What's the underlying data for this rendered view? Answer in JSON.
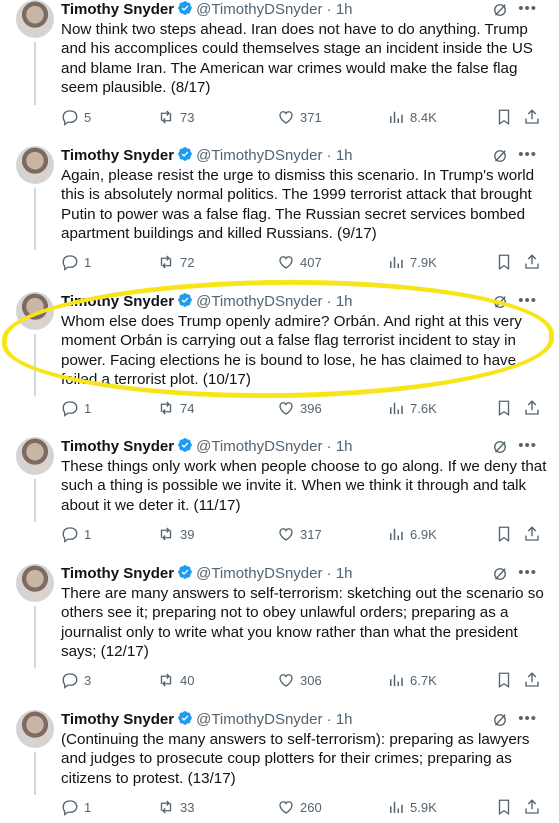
{
  "tweets": [
    {
      "name": "Timothy Snyder",
      "handle": "@TimothyDSnyder",
      "sep": "·",
      "time": "1h",
      "text": "Now think two steps ahead. Iran does not have to do anything. Trump and his accomplices could themselves stage an incident inside the US and blame Iran. The American war crimes would make the false flag seem plausible. (8/17)",
      "replies": "5",
      "reposts": "73",
      "likes": "371",
      "views": "8.4K"
    },
    {
      "name": "Timothy Snyder",
      "handle": "@TimothyDSnyder",
      "sep": "·",
      "time": "1h",
      "text": "Again, please resist the urge to dismiss this scenario. In Trump's world this is absolutely normal politics. The 1999 terrorist attack that brought Putin to power was a false flag. The Russian secret services bombed apartment buildings and killed Russians. (9/17)",
      "replies": "1",
      "reposts": "72",
      "likes": "407",
      "views": "7.9K"
    },
    {
      "name": "Timothy Snyder",
      "handle": "@TimothyDSnyder",
      "sep": "·",
      "time": "1h",
      "text": "Whom else does Trump openly admire? Orbán. And right at this very moment Orbán is carrying out a false flag terrorist incident to stay in power. Facing elections he is bound to lose, he has claimed to have foiled a terrorist plot. (10/17)",
      "replies": "1",
      "reposts": "74",
      "likes": "396",
      "views": "7.6K"
    },
    {
      "name": "Timothy Snyder",
      "handle": "@TimothyDSnyder",
      "sep": "·",
      "time": "1h",
      "text": "These things only work when people choose to go along. If we deny that such a thing is possible we invite it. When we think it through and talk about it we deter it. (11/17)",
      "replies": "1",
      "reposts": "39",
      "likes": "317",
      "views": "6.9K"
    },
    {
      "name": "Timothy Snyder",
      "handle": "@TimothyDSnyder",
      "sep": "·",
      "time": "1h",
      "text": "There are many answers to self-terrorism: sketching out the scenario so others see it; preparing not to obey unlawful orders; preparing as a journalist only to write what you know rather than what the president says; (12/17)",
      "replies": "3",
      "reposts": "40",
      "likes": "306",
      "views": "6.7K"
    },
    {
      "name": "Timothy Snyder",
      "handle": "@TimothyDSnyder",
      "sep": "·",
      "time": "1h",
      "text": "(Continuing the many answers to self-terrorism): preparing as lawyers and judges to prosecute coup plotters for their crimes; preparing as citizens to protest. (13/17)",
      "replies": "1",
      "reposts": "33",
      "likes": "260",
      "views": "5.9K"
    }
  ],
  "icons": {
    "verified": "verified-badge-icon",
    "grok": "grok-icon",
    "more": "more-icon",
    "reply": "reply-icon",
    "repost": "repost-icon",
    "like": "like-icon",
    "views": "views-icon",
    "bookmark": "bookmark-icon",
    "share": "share-icon"
  },
  "colors": {
    "verified": "#1d9bf0",
    "highlight": "#f7e51a",
    "muted": "#536471"
  }
}
